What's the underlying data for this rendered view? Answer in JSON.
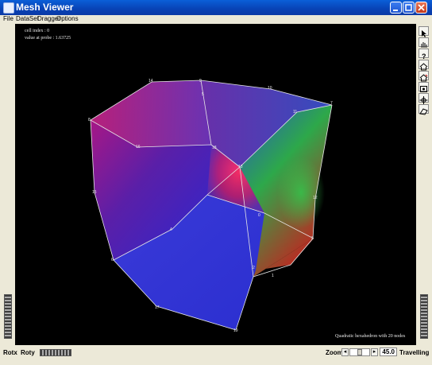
{
  "window": {
    "title": "Mesh Viewer"
  },
  "menu": {
    "items": [
      "File",
      "DataSet",
      "Dragger",
      "Options"
    ]
  },
  "viewport": {
    "info_lines": [
      "cell index : 0",
      "value at probe : 1.63725"
    ],
    "caption": "Quadratic hexahedron with 20 nodes",
    "node_labels": [
      "14",
      "9",
      "10",
      "7",
      "5",
      "8",
      "16",
      "11",
      "18",
      "13",
      "15",
      "12",
      "4",
      "0",
      "3",
      "6",
      "2",
      "1",
      "17",
      "19"
    ]
  },
  "right_toolbar": {
    "icons": [
      "arrow-select-icon",
      "hand-icon",
      "help-icon",
      "home-icon",
      "set-home-icon",
      "view-all-icon",
      "seek-icon",
      "perspective-icon"
    ]
  },
  "bottom_bar": {
    "rotx_label": "Rotx",
    "roty_label": "Roty",
    "zoom_label": "Zoom",
    "zoom_value": "45.0",
    "mode_label": "Travelling",
    "zoom_left_arrow": "◂",
    "zoom_right_arrow": "▸"
  },
  "colors": {
    "title_bar": "#0842b5",
    "viewport_bg": "#000000",
    "edge": "#e6e6e6"
  }
}
